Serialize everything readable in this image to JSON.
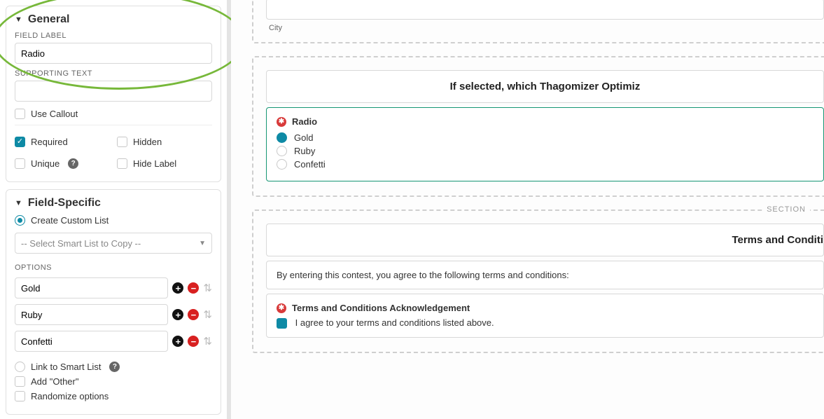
{
  "sidebar": {
    "general": {
      "title": "General",
      "fieldLabelHeader": "FIELD LABEL",
      "fieldLabelValue": "Radio",
      "supportingTextHeader": "SUPPORTING TEXT",
      "supportingTextValue": "",
      "useCallout": "Use Callout",
      "required": "Required",
      "hidden": "Hidden",
      "unique": "Unique",
      "hideLabel": "Hide Label"
    },
    "fieldSpecific": {
      "title": "Field-Specific",
      "createCustomList": "Create Custom List",
      "smartListPlaceholder": "-- Select Smart List to Copy --",
      "optionsHeader": "OPTIONS",
      "options": [
        "Gold",
        "Ruby",
        "Confetti"
      ],
      "linkSmartList": "Link to Smart List",
      "addOther": "Add \"Other\"",
      "randomize": "Randomize options"
    }
  },
  "preview": {
    "city": {
      "belowLabel": "City"
    },
    "thagomizer": {
      "title": "If selected, which Thagomizer Optimiz",
      "fieldTitle": "Radio",
      "options": [
        "Gold",
        "Ruby",
        "Confetti"
      ]
    },
    "terms": {
      "sectionTag": "SECTION",
      "title": "Terms and Conditi",
      "intro": "By entering this contest, you agree to the following terms and conditions:",
      "ackTitle": "Terms and Conditions Acknowledgement",
      "ackText": "I agree to your terms and conditions listed above."
    }
  }
}
